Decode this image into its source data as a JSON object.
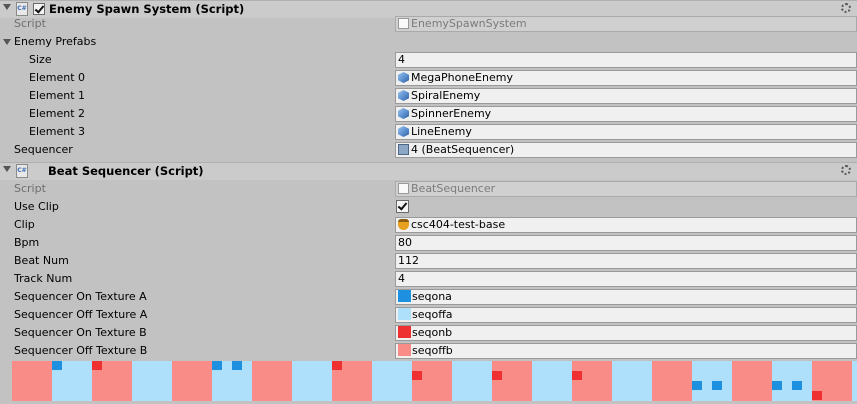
{
  "colors": {
    "seq_on_a": "#1e90e0",
    "seq_off_a": "#aee0fb",
    "seq_on_b": "#ee3030",
    "seq_off_b": "#fa8c88"
  },
  "enemy_spawn": {
    "title": "Enemy Spawn System (Script)",
    "enabled": true,
    "script_label": "Script",
    "script_value": "EnemySpawnSystem",
    "prefabs_label": "Enemy Prefabs",
    "size_label": "Size",
    "size_value": "4",
    "elements": [
      {
        "label": "Element 0",
        "value": "MegaPhoneEnemy"
      },
      {
        "label": "Element 1",
        "value": "SpiralEnemy"
      },
      {
        "label": "Element 2",
        "value": "SpinnerEnemy"
      },
      {
        "label": "Element 3",
        "value": "LineEnemy"
      }
    ],
    "sequencer_label": "Sequencer",
    "sequencer_value": "4 (BeatSequencer)"
  },
  "beat_sequencer": {
    "title": "Beat Sequencer (Script)",
    "script_label": "Script",
    "script_value": "BeatSequencer",
    "use_clip_label": "Use Clip",
    "use_clip": true,
    "clip_label": "Clip",
    "clip_value": "csc404-test-base",
    "bpm_label": "Bpm",
    "bpm_value": "80",
    "beat_num_label": "Beat Num",
    "beat_num_value": "112",
    "track_num_label": "Track Num",
    "track_num_value": "4",
    "tex_on_a_label": "Sequencer On Texture A",
    "tex_on_a_value": "seqona",
    "tex_off_a_label": "Sequencer Off Texture A",
    "tex_off_a_value": "seqoffa",
    "tex_on_b_label": "Sequencer On Texture B",
    "tex_on_b_value": "seqonb",
    "tex_off_b_label": "Sequencer Off Texture B",
    "tex_off_b_value": "seqoffb"
  },
  "preview": {
    "cells": [
      {
        "group": "b",
        "on": []
      },
      {
        "group": "a",
        "on": [
          0
        ]
      },
      {
        "group": "b",
        "on": [
          0
        ]
      },
      {
        "group": "a",
        "on": []
      },
      {
        "group": "b",
        "on": []
      },
      {
        "group": "a",
        "on": [
          0,
          1
        ]
      },
      {
        "group": "b",
        "on": []
      },
      {
        "group": "a",
        "on": []
      },
      {
        "group": "b",
        "on": [
          0
        ]
      },
      {
        "group": "a",
        "on": []
      },
      {
        "group": "b",
        "on": [
          2
        ]
      },
      {
        "group": "a",
        "on": []
      },
      {
        "group": "b",
        "on": [
          2
        ]
      },
      {
        "group": "a",
        "on": []
      },
      {
        "group": "b",
        "on": [
          2
        ]
      },
      {
        "group": "a",
        "on": []
      },
      {
        "group": "b",
        "on": []
      },
      {
        "group": "a",
        "on": [
          3,
          4
        ]
      },
      {
        "group": "b",
        "on": []
      },
      {
        "group": "a",
        "on": [
          3,
          4
        ]
      },
      {
        "group": "b",
        "on": [
          5
        ]
      },
      {
        "group": "a",
        "on": []
      }
    ]
  }
}
